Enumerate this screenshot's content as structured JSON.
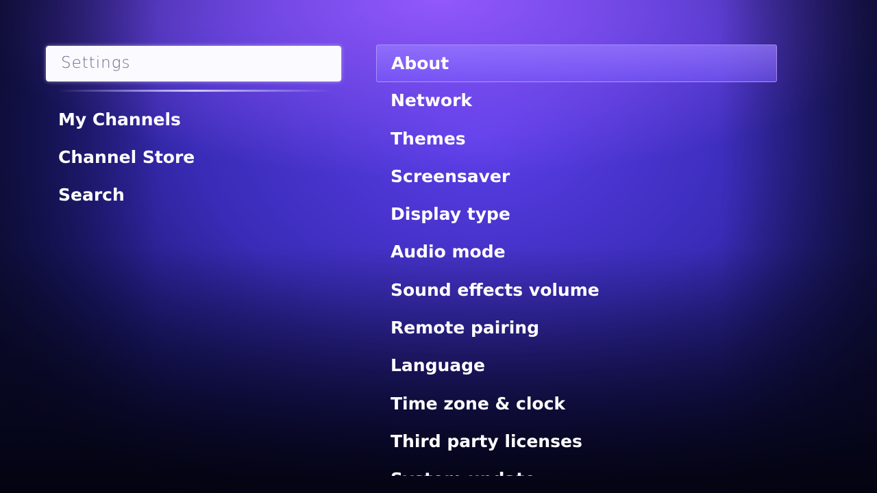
{
  "header": {
    "title": "Settings"
  },
  "left_nav": {
    "items": [
      {
        "label": "My Channels"
      },
      {
        "label": "Channel Store"
      },
      {
        "label": "Search"
      }
    ]
  },
  "settings_menu": {
    "selected_index": 0,
    "items": [
      {
        "label": "About"
      },
      {
        "label": "Network"
      },
      {
        "label": "Themes"
      },
      {
        "label": "Screensaver"
      },
      {
        "label": "Display type"
      },
      {
        "label": "Audio mode"
      },
      {
        "label": "Sound effects volume"
      },
      {
        "label": "Remote pairing"
      },
      {
        "label": "Language"
      },
      {
        "label": "Time zone & clock"
      },
      {
        "label": "Third party licenses"
      },
      {
        "label": "System update"
      }
    ]
  },
  "colors": {
    "background": "#3a2cb8",
    "highlight": "#fbfbff",
    "selection": "#8a6cff"
  }
}
